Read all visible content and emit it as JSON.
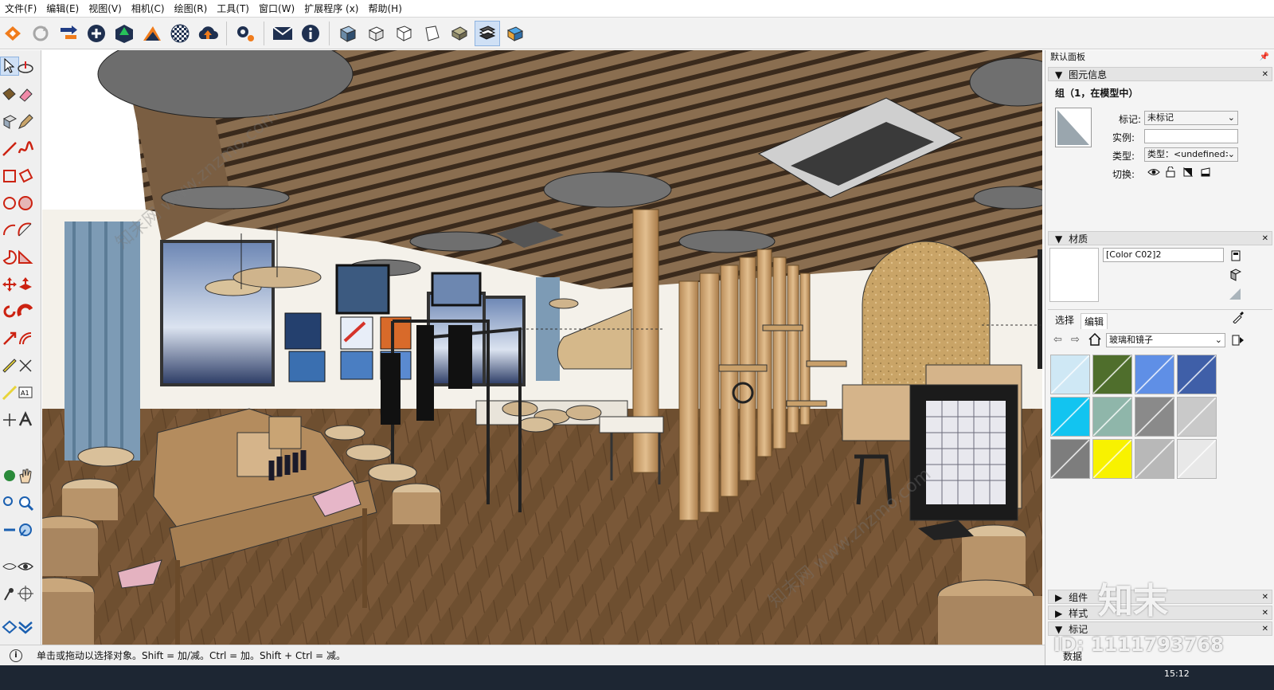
{
  "menu": [
    "文件(F)",
    "编辑(E)",
    "视图(V)",
    "相机(C)",
    "绘图(R)",
    "工具(T)",
    "窗口(W)",
    "扩展程序 (x)",
    "帮助(H)"
  ],
  "toolbar_icons": [
    "warehouse-icon",
    "sync-icon",
    "extension-icon",
    "add-icon",
    "tree-icon",
    "layers-icon",
    "checker-icon",
    "cloud-upload-icon",
    "gears-icon",
    "mail-icon",
    "info-icon",
    "iso-view-icon",
    "top-view-icon",
    "front-view-icon",
    "right-view-icon",
    "back-view-icon",
    "left-view-icon",
    "bottom-view-icon"
  ],
  "panel": {
    "title": "默认面板",
    "pin": "❑",
    "entity_info": {
      "header": "图元信息",
      "subtitle": "组（1，在模型中）",
      "tag_label": "标记:",
      "tag_value": "未标记",
      "instance_label": "实例:",
      "instance_value": "",
      "type_label": "类型:",
      "type_value": "类型：<undefined>",
      "toggle_label": "切换:"
    },
    "materials": {
      "header": "材质",
      "name": "[Color C02]2",
      "tab_select": "选择",
      "tab_edit": "编辑",
      "library": "玻璃和镜子",
      "swatch_colors": [
        "#cfe8f5",
        "#4f6e2c",
        "#5f8fe6",
        "#3f5fa8",
        "#12c4f0",
        "#8fb6aa",
        "#8a8a8a",
        "#c9c9c9",
        "#7d7d7d",
        "#f8f200",
        "#b8b8b8",
        "#e8e8e8"
      ]
    },
    "components": "组件",
    "styles": "样式",
    "tags": "标记",
    "data_label": "数据"
  },
  "status": {
    "hint": "单击或拖动以选择对象。Shift = 加/减。Ctrl = 加。Shift + Ctrl = 减。",
    "info_icon": "i"
  },
  "watermark": {
    "brand": "知末",
    "id": "ID: 1111793768",
    "site": "知末网 www.znzmo.com"
  },
  "clock": "15:12"
}
